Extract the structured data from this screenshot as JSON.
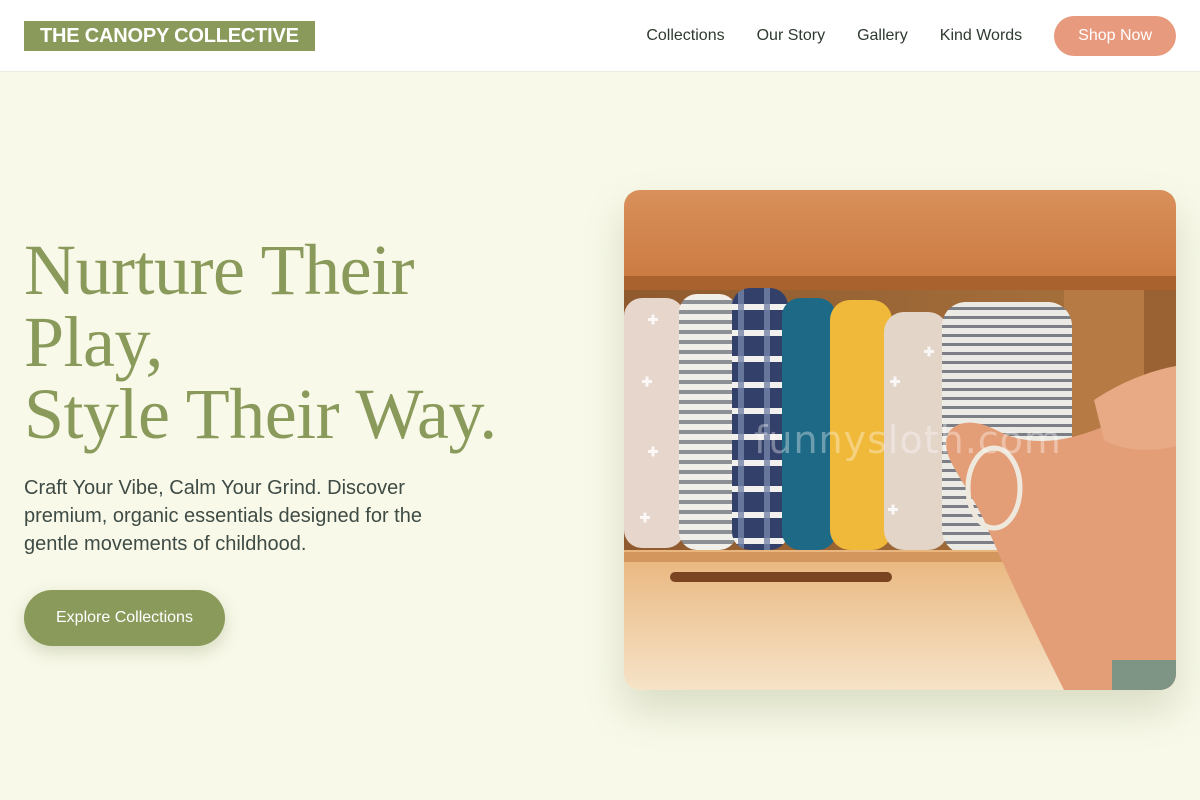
{
  "header": {
    "brand": "THE CANOPY COLLECTIVE",
    "nav": [
      "Collections",
      "Our Story",
      "Gallery",
      "Kind Words"
    ],
    "cta": "Shop Now"
  },
  "hero": {
    "title_lines": [
      "Nurture Their",
      "Play,",
      "Style Their Way."
    ],
    "subtitle": "Craft Your Vibe, Calm Your Grind. Discover premium, organic essentials designed for the gentle movements of childhood.",
    "cta": "Explore Collections",
    "image": {
      "subject": "folded muslin blankets in a wooden drawer",
      "watermark": "funnysloth.com"
    }
  },
  "colors": {
    "brand": "#8a9a5b",
    "accent": "#e89a7e",
    "background": "#f8f9e9",
    "text": "#3f4b45"
  }
}
